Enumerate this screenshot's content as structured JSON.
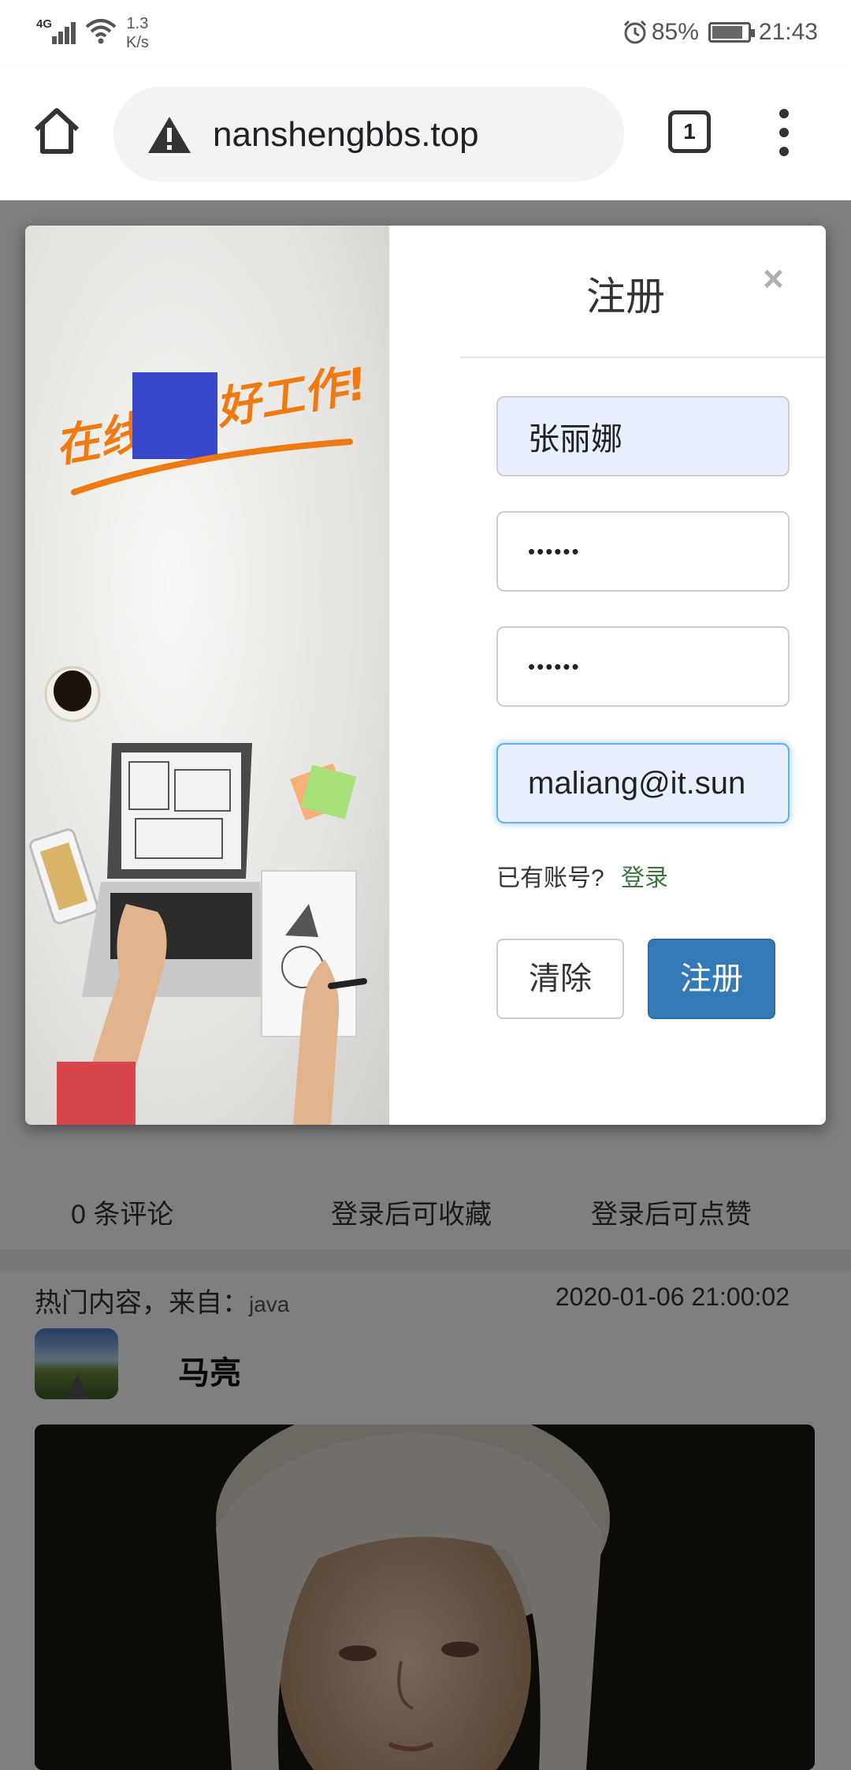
{
  "status_bar": {
    "network": "4G",
    "speed_value": "1.3",
    "speed_unit": "K/s",
    "battery": "85%",
    "time": "21:43"
  },
  "browser": {
    "url": "nanshengbbs.top",
    "tab_count": "1"
  },
  "page": {
    "comments": "0 条评论",
    "favorite_hint": "登录后可收藏",
    "like_hint": "登录后可点赞",
    "hot_label": "热门内容，来自：",
    "hot_source": "java",
    "hot_time": "2020-01-06 21:00:02",
    "author": "马亮"
  },
  "modal": {
    "title": "注册",
    "close": "×",
    "banner_left": "在线",
    "banner_right": "好工作!",
    "fields": {
      "username": "张丽娜",
      "password": "••••••",
      "confirm_password": "••••••",
      "email": "maliang@it.sun"
    },
    "have_account": "已有账号?",
    "login_link": "登录",
    "clear_button": "清除",
    "register_button": "注册"
  },
  "colors": {
    "primary_button": "#337ab7",
    "login_link": "#3c763d",
    "banner_text": "#f07a12",
    "censor_block": "#3a47c8"
  }
}
